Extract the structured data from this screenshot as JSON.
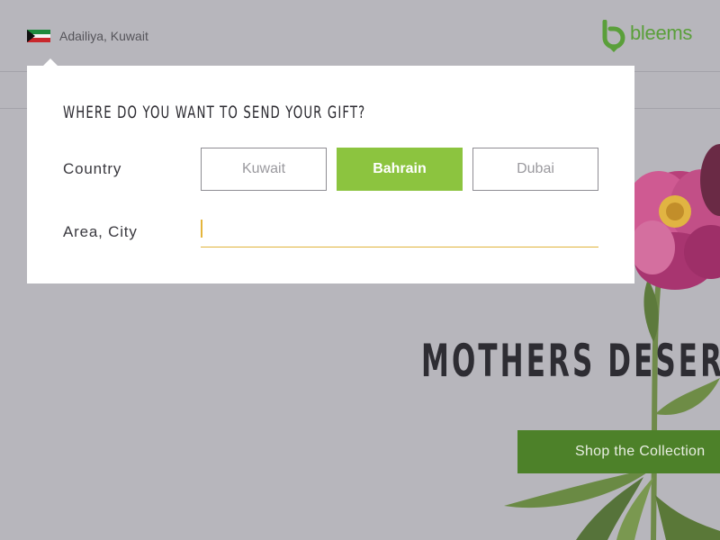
{
  "header": {
    "location": "Adailiya, Kuwait",
    "flag_icon": "kuwait-flag-icon",
    "logo_text": "bleems",
    "logo_icon": "bleems-logo-icon"
  },
  "popup": {
    "title": "WHERE DO YOU WANT TO SEND YOUR GIFT?",
    "country_label": "Country",
    "area_label": "Area, City",
    "area_value": "",
    "area_placeholder": "",
    "countries": [
      {
        "label": "Kuwait",
        "selected": false
      },
      {
        "label": "Bahrain",
        "selected": true
      },
      {
        "label": "Dubai",
        "selected": false
      }
    ]
  },
  "hero": {
    "title": "MOTHERS DESERV",
    "cta_label": "Shop the Collection"
  },
  "colors": {
    "brand_green": "#5a9f3a",
    "selected_green": "#8cc43f",
    "cta_green": "#4d8129",
    "input_underline": "#e0b23a",
    "background": "#b7b6bc"
  }
}
